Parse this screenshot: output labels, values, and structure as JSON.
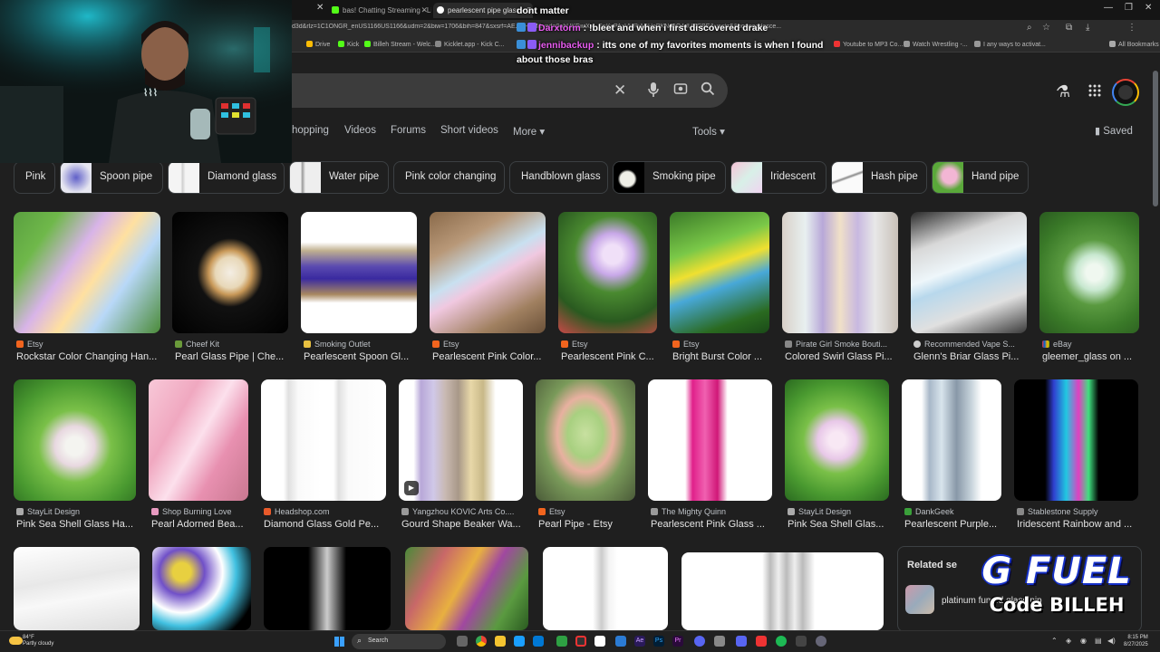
{
  "browser": {
    "tabs": [
      {
        "title": "bas! Chatting Streaming - Liv"
      },
      {
        "title": "pearlescent pipe glass - Go"
      }
    ],
    "url": "d3d&rlz=1C1ONGR_enUS1166US1166&udm=2&biw=1706&bih=847&sxsrf=AE...vf-QM&ved=0ahUKEwiXi4_SnKyPAxVURjABHePKNz8Q4dUDCBE&uact=5&oq=pearlesce...",
    "bookmarks": [
      "Drive",
      "Kick",
      "Billeh Stream - Welc...",
      "Kicklet.app - Kick C...",
      "Youtube to MP3 Co...",
      "Watch Wrestling -...",
      "I any ways to activat...",
      "All Bookmarks"
    ]
  },
  "search": {
    "tabs": [
      "hopping",
      "Videos",
      "Forums",
      "Short videos",
      "More"
    ],
    "tools_label": "Tools",
    "saved_label": "Saved"
  },
  "chips": [
    {
      "label": "Pink"
    },
    {
      "label": "Spoon pipe"
    },
    {
      "label": "Diamond glass"
    },
    {
      "label": "Water pipe"
    },
    {
      "label": "Pink color changing"
    },
    {
      "label": "Handblown glass"
    },
    {
      "label": "Smoking pipe"
    },
    {
      "label": "Iridescent"
    },
    {
      "label": "Hash pipe"
    },
    {
      "label": "Hand pipe"
    }
  ],
  "results_row1": [
    {
      "source": "Etsy",
      "title": "Rockstar Color Changing Han..."
    },
    {
      "source": "Cheef Kit",
      "title": "Pearl Glass Pipe | Che..."
    },
    {
      "source": "Smoking Outlet",
      "title": "Pearlescent Spoon Gl..."
    },
    {
      "source": "Etsy",
      "title": "Pearlescent Pink Color..."
    },
    {
      "source": "Etsy",
      "title": "Pearlescent Pink C..."
    },
    {
      "source": "Etsy",
      "title": "Bright Burst Color ..."
    },
    {
      "source": "Pirate Girl Smoke Bouti...",
      "title": "Colored Swirl Glass Pi..."
    },
    {
      "source": "Recommended Vape S...",
      "title": "Glenn's Briar Glass Pi..."
    },
    {
      "source": "eBay",
      "title": "gleemer_glass on ..."
    }
  ],
  "results_row2": [
    {
      "source": "StayLit Design",
      "title": "Pink Sea Shell Glass Ha..."
    },
    {
      "source": "Shop Burning Love",
      "title": "Pearl Adorned Bea..."
    },
    {
      "source": "Headshop.com",
      "title": "Diamond Glass Gold Pe..."
    },
    {
      "source": "Yangzhou KOVIC Arts Co....",
      "title": "Gourd Shape Beaker Wa..."
    },
    {
      "source": "Etsy",
      "title": "Pearl Pipe - Etsy"
    },
    {
      "source": "The Mighty Quinn",
      "title": "Pearlescent Pink Glass ..."
    },
    {
      "source": "StayLit Design",
      "title": "Pink Sea Shell Glas..."
    },
    {
      "source": "DankGeek",
      "title": "Pearlescent Purple..."
    },
    {
      "source": "Stablestone Supply",
      "title": "Iridescent Rainbow and ..."
    }
  ],
  "related": {
    "heading": "Related se",
    "item": "platinum fumed glass pip"
  },
  "chat": [
    {
      "user": "",
      "text": "dont matter"
    },
    {
      "user": "Darxtorm",
      "text": "!bleet and when i first discovered drake"
    },
    {
      "user": "jennibackup",
      "text": "itts one of my favorites moments is when I found"
    },
    {
      "user": "",
      "text": "about those bras"
    }
  ],
  "sponsor": {
    "logo": "G FUEL",
    "code": "Code BILLEH"
  },
  "taskbar": {
    "weather_temp": "84°F",
    "weather_desc": "Partly cloudy",
    "search_label": "Search",
    "time": "8:15 PM",
    "date": "8/27/2025"
  }
}
